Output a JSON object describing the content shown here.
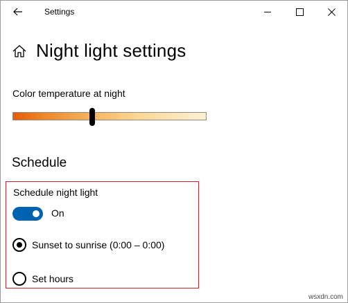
{
  "window": {
    "title": "Settings"
  },
  "page": {
    "title": "Night light settings"
  },
  "color_temperature": {
    "label": "Color temperature at night",
    "level": 0.41
  },
  "schedule": {
    "heading": "Schedule",
    "label": "Schedule night light",
    "toggle_state_label": "On",
    "toggle_on": true,
    "options": [
      {
        "label": "Sunset to sunrise (0:00 – 0:00)",
        "selected": true
      },
      {
        "label": "Set hours",
        "selected": false
      }
    ]
  },
  "icons": {
    "back": "back-arrow-icon",
    "minimize": "minimize-icon",
    "maximize": "maximize-icon",
    "close": "close-icon",
    "home": "home-icon"
  },
  "colors": {
    "accent": "#0063b1",
    "highlight_border": "#c8232c"
  },
  "watermark": "wsxdn.com"
}
